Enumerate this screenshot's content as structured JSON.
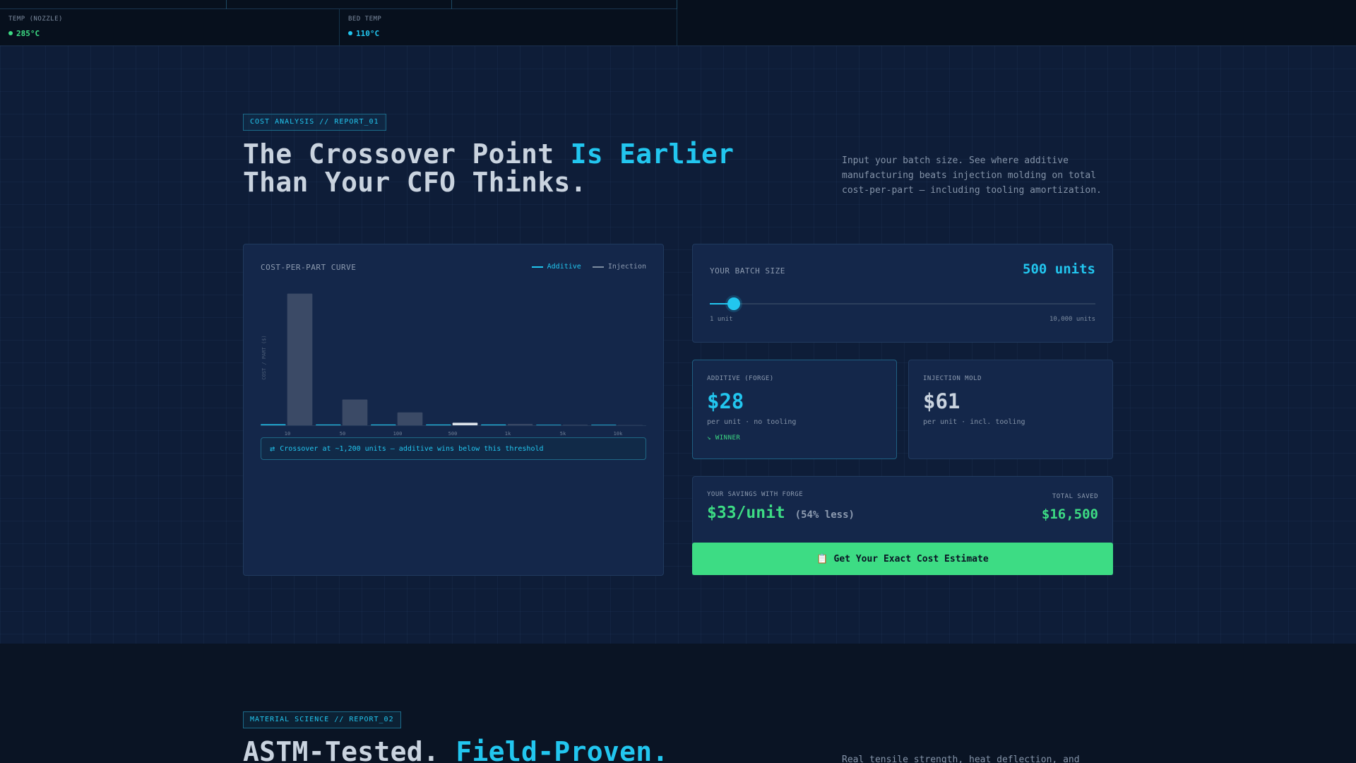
{
  "status_bar": {
    "items": [
      {
        "label": "TEMP (NOZZLE)",
        "value": "285°C",
        "color": "#3ddc84"
      },
      {
        "label": "BED TEMP",
        "value": "110°C",
        "color": "#22c6ef"
      }
    ]
  },
  "cost_section": {
    "tag": "COST ANALYSIS // REPORT_01",
    "headline_part1": "The Crossover Point ",
    "headline_accent": "Is Earlier",
    "headline_part2": "Than Your CFO Thinks.",
    "description": "Input your batch size. See where additive manufacturing beats injection molding on total cost-per-part — including tooling amortization.",
    "chart": {
      "title": "COST-PER-PART CURVE",
      "legend_additive": "Additive",
      "legend_injection": "Injection",
      "callout": "Crossover at ~1,200 units — additive wins below this threshold",
      "callout_icon": "swap-arrows-icon"
    },
    "batch": {
      "label": "YOUR BATCH SIZE",
      "value": "500 units",
      "min_label": "1 unit",
      "max_label": "10,000 units",
      "slider_fraction": 0.063
    },
    "additive_card": {
      "label": "ADDITIVE (FORGE)",
      "price": "$28",
      "sub": "per unit · no tooling",
      "winner": "↘ WINNER"
    },
    "injection_card": {
      "label": "INJECTION MOLD",
      "price": "$61",
      "sub": "per unit · incl. tooling"
    },
    "savings": {
      "label": "YOUR SAVINGS WITH FORGE",
      "value": "$33/unit",
      "pct": "(54% less)",
      "total_label": "TOTAL SAVED",
      "total": "$16,500"
    },
    "cta": {
      "label": "Get Your Exact Cost Estimate",
      "icon": "clipboard-icon"
    }
  },
  "material_section": {
    "tag": "MATERIAL SCIENCE // REPORT_02",
    "headline_part1": "ASTM-Tested. ",
    "headline_accent": "Field-Proven.",
    "description": "Real tensile strength, heat deflection, and"
  },
  "colors": {
    "accent": "#22c6ef",
    "success": "#3ddc84",
    "injection_bar": "#3b4a66",
    "selected_bar": "#dde3ea"
  },
  "chart_data": {
    "type": "bar",
    "title": "COST-PER-PART CURVE",
    "xlabel": "",
    "ylabel": "COST / PART ($)",
    "categories": [
      "10",
      "50",
      "100",
      "500",
      "1k",
      "5k",
      "10k"
    ],
    "selected_category": "500",
    "ylim": [
      0,
      520
    ],
    "series": [
      {
        "name": "Additive",
        "values": [
          4,
          3,
          3,
          3,
          3,
          2,
          2
        ]
      },
      {
        "name": "Injection",
        "values": [
          510,
          100,
          50,
          10,
          5,
          2,
          1
        ]
      }
    ],
    "legend": "top-right"
  }
}
